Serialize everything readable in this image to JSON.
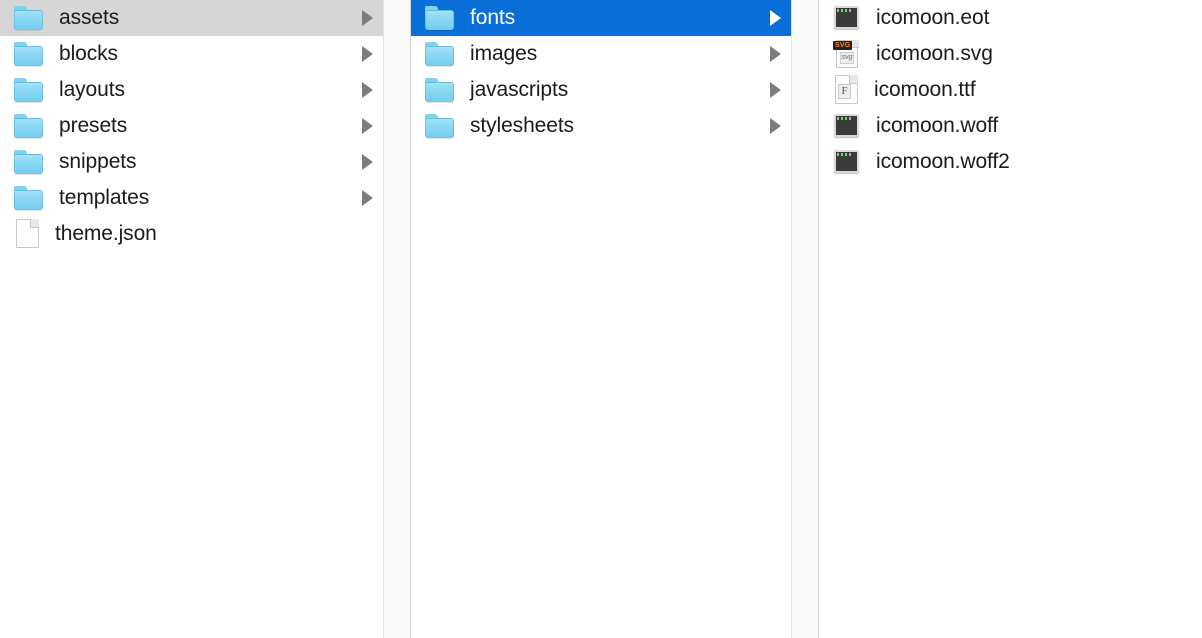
{
  "view": {
    "name": "finder-column-view",
    "selection_active_color": "#0a6fd8",
    "selection_inactive_color": "#d6d6d6",
    "background_color": "#ffffff",
    "gutter_color": "#fafafa",
    "text_color": "#1b1b1b",
    "selected_text_color": "#ffffff",
    "folder_icon_color": "#7fd2f2"
  },
  "columns": [
    {
      "name": "column-theme-root",
      "items": [
        {
          "label": "assets",
          "icon": "folder-icon",
          "has_chevron": true,
          "selected": "inactive"
        },
        {
          "label": "blocks",
          "icon": "folder-icon",
          "has_chevron": true,
          "selected": "none"
        },
        {
          "label": "layouts",
          "icon": "folder-icon",
          "has_chevron": true,
          "selected": "none"
        },
        {
          "label": "presets",
          "icon": "folder-icon",
          "has_chevron": true,
          "selected": "none"
        },
        {
          "label": "snippets",
          "icon": "folder-icon",
          "has_chevron": true,
          "selected": "none"
        },
        {
          "label": "templates",
          "icon": "folder-icon",
          "has_chevron": true,
          "selected": "none"
        },
        {
          "label": "theme.json",
          "icon": "document-file-icon",
          "has_chevron": false,
          "selected": "none"
        }
      ]
    },
    {
      "name": "column-assets",
      "items": [
        {
          "label": "fonts",
          "icon": "folder-icon",
          "has_chevron": true,
          "selected": "active"
        },
        {
          "label": "images",
          "icon": "folder-icon",
          "has_chevron": true,
          "selected": "none"
        },
        {
          "label": "javascripts",
          "icon": "folder-icon",
          "has_chevron": true,
          "selected": "none"
        },
        {
          "label": "stylesheets",
          "icon": "folder-icon",
          "has_chevron": true,
          "selected": "none"
        }
      ]
    },
    {
      "name": "column-fonts",
      "items": [
        {
          "label": "icomoon.eot",
          "icon": "binary-file-icon",
          "has_chevron": false,
          "selected": "none"
        },
        {
          "label": "icomoon.svg",
          "icon": "svg-file-icon",
          "has_chevron": false,
          "selected": "none",
          "badge": "SVG",
          "inner_label": "svg"
        },
        {
          "label": "icomoon.ttf",
          "icon": "font-file-icon",
          "has_chevron": false,
          "selected": "none",
          "glyph": "F"
        },
        {
          "label": "icomoon.woff",
          "icon": "binary-file-icon",
          "has_chevron": false,
          "selected": "none"
        },
        {
          "label": "icomoon.woff2",
          "icon": "binary-file-icon",
          "has_chevron": false,
          "selected": "none"
        }
      ]
    }
  ]
}
